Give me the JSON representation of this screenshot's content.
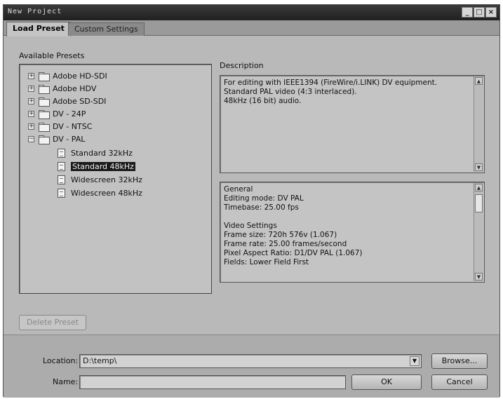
{
  "window": {
    "title": "New Project",
    "minimize": "_",
    "maximize": "□",
    "close": "×"
  },
  "tabs": [
    {
      "label": "Load Preset"
    },
    {
      "label": "Custom Settings"
    }
  ],
  "available_presets": {
    "label": "Available Presets",
    "folders": [
      {
        "label": "Adobe HD-SDI",
        "expander": "+"
      },
      {
        "label": "Adobe HDV",
        "expander": "+"
      },
      {
        "label": "Adobe SD-SDI",
        "expander": "+"
      },
      {
        "label": "DV - 24P",
        "expander": "+"
      },
      {
        "label": "DV - NTSC",
        "expander": "+"
      },
      {
        "label": "DV - PAL",
        "expander": "−"
      }
    ],
    "presets": [
      {
        "label": "Standard 32kHz"
      },
      {
        "label": "Standard 48kHz",
        "selected": true
      },
      {
        "label": "Widescreen 32kHz"
      },
      {
        "label": "Widescreen 48kHz"
      }
    ]
  },
  "description": {
    "label": "Description",
    "lines": [
      "For editing with IEEE1394 (FireWire/i.LINK) DV equipment.",
      "Standard PAL video (4:3 interlaced).",
      "48kHz (16 bit) audio."
    ]
  },
  "settings_info": {
    "lines": [
      "General",
      "Editing mode: DV PAL",
      "Timebase: 25.00 fps",
      "",
      "Video Settings",
      "Frame size: 720h 576v (1.067)",
      "Frame rate: 25.00 frames/second",
      "Pixel Aspect Ratio: D1/DV PAL (1.067)",
      "Fields: Lower Field First"
    ]
  },
  "buttons": {
    "delete_preset": "Delete Preset",
    "browse": "Browse...",
    "ok": "OK",
    "cancel": "Cancel"
  },
  "location": {
    "label": "Location:",
    "value": "D:\\temp\\"
  },
  "name": {
    "label": "Name:",
    "value": ""
  },
  "icons": {
    "scroll_up": "▲",
    "scroll_down": "▼",
    "dropdown": "▼"
  }
}
